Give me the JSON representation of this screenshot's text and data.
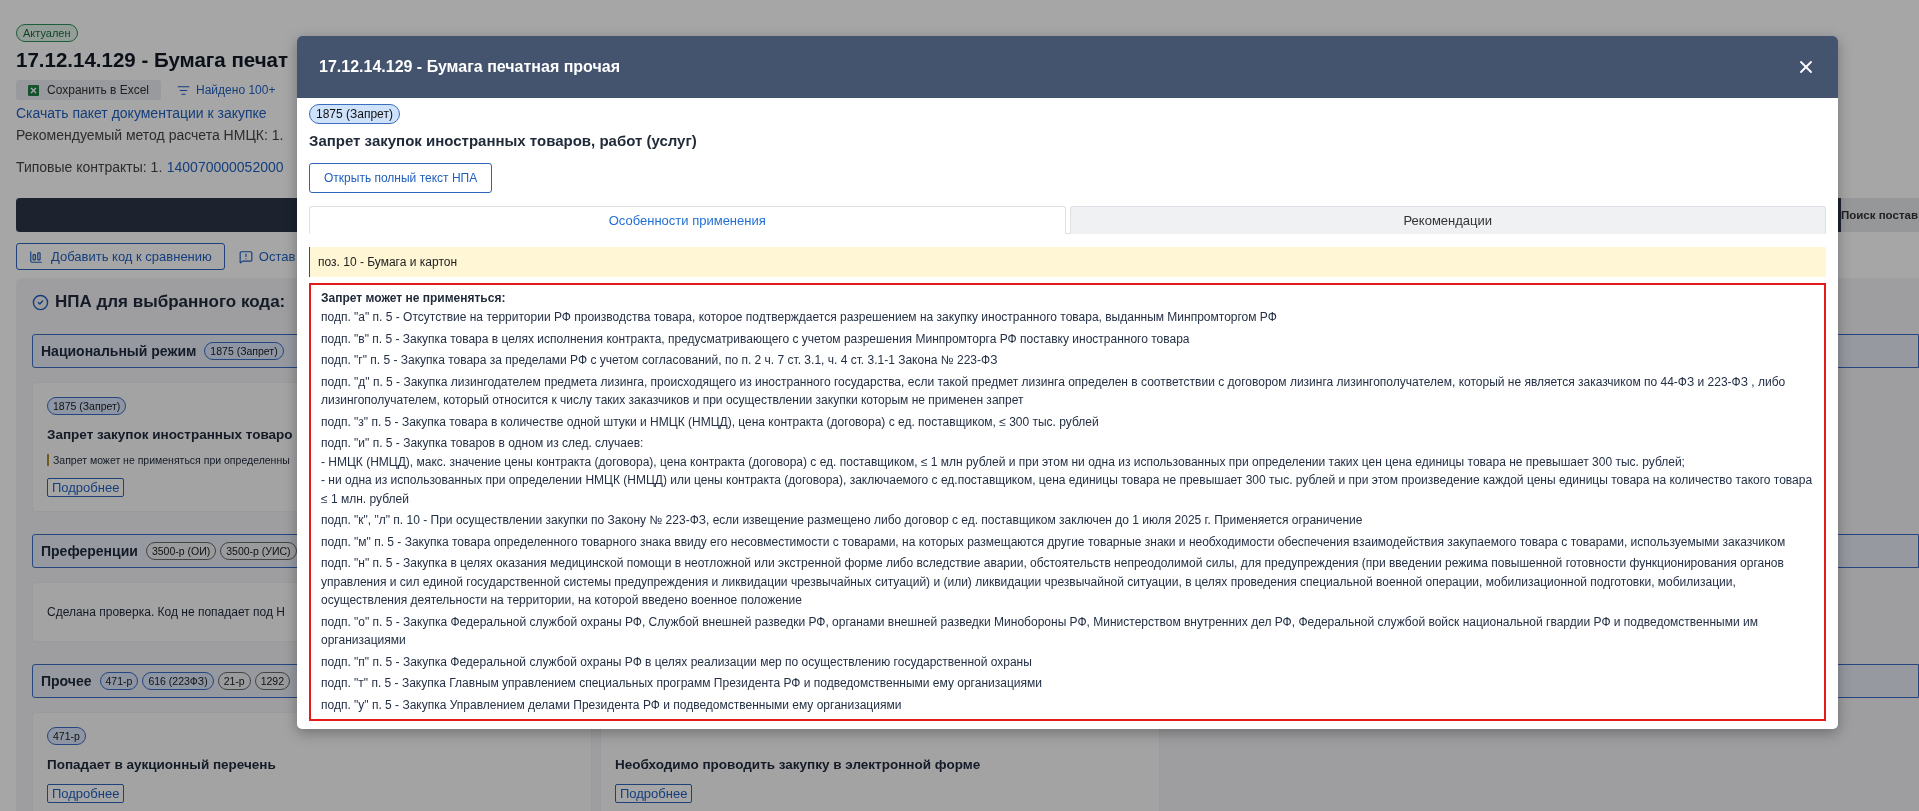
{
  "background": {
    "status_badge": "Актуален",
    "title": "17.12.14.129 - Бумага печат",
    "actions": [
      {
        "kind": "excel",
        "label": "Сохранить в Excel"
      },
      {
        "kind": "found",
        "label": "Найдено 100+"
      }
    ],
    "download_link": "Скачать пакет документации к закупке",
    "method": "Рекомендуемый метод расчета НМЦК: 1.",
    "contracts": {
      "label": "Типовые контракты: 1.",
      "link": "140070000052000"
    },
    "right_tab": "Поиск постав",
    "buttons": [
      {
        "kind": "compare",
        "label": "Добавить код к сравнению"
      },
      {
        "kind": "comment",
        "label": "Остав"
      }
    ],
    "npa_heading": "НПА для выбранного кода:",
    "sections": [
      {
        "title": "Национальный режим",
        "chips": [
          {
            "label": "1875 (Запрет)",
            "color": "#8e96a3"
          }
        ],
        "cards": [
          {
            "chip": "1875 (Запрет)",
            "title": "Запрет закупок иностранных товаро",
            "note": "Запрет может не применяться при определенны",
            "more": "Подробнее"
          }
        ]
      },
      {
        "title": "Преференции",
        "chips": [
          {
            "label": "3500-р (ОИ)",
            "color": "#999b9d"
          },
          {
            "label": "3500-р (УИС)",
            "color": "#999b9d"
          }
        ],
        "cards": [
          {
            "text": "Сделана проверка. Код не попадает под Н"
          }
        ]
      },
      {
        "title": "Прочее",
        "chips": [
          {
            "label": "471-р",
            "color": "#8e96a3"
          },
          {
            "label": "616 (223ФЗ)",
            "color": "#8e96a3"
          },
          {
            "label": "21-р",
            "color": "#999b9d"
          },
          {
            "label": "1292",
            "color": "#999b9d"
          }
        ],
        "cards": [
          {
            "chip": "471-р",
            "title": "Попадает в аукционный перечень",
            "more": "Подробнее"
          },
          {
            "title": "Необходимо проводить закупку в электронной форме",
            "more": "Подробнее"
          }
        ]
      }
    ]
  },
  "modal": {
    "title": "17.12.14.129 - Бумага печатная прочая",
    "chip": "1875 (Запрет)",
    "heading": "Запрет закупок иностранных товаров, работ (услуг)",
    "open_button": "Открыть полный текст НПА",
    "tabs": [
      {
        "label": "Особенности применения",
        "selected": true
      },
      {
        "label": "Рекомендации",
        "selected": false
      }
    ],
    "position_note": "поз. 10 - Бумага и картон",
    "exceptions": {
      "title": "Запрет может не применяться:",
      "items": [
        {
          "lines": [
            "подп. \"а\" п. 5 - Отсутствие на территории РФ производства товара, которое подтверждается разрешением на закупку иностранного товара, выданным Минпромторгом РФ"
          ]
        },
        {
          "lines": [
            "подп. \"в\" п. 5 - Закупка товара в целях исполнения контракта, предусматривающего с учетом разрешения Минпромторга РФ поставку иностранного товара"
          ]
        },
        {
          "lines": [
            "подп. \"г\" п. 5 - Закупка товара за пределами РФ с учетом согласований, по п. 2 ч. 7 ст. 3.1, ч. 4 ст. 3.1-1 Закона № 223-ФЗ"
          ]
        },
        {
          "lines": [
            "подп. \"д\" п. 5 - Закупка лизингодателем предмета лизинга, происходящего из иностранного государства, если такой предмет лизинга определен в соответствии с договором лизинга лизингополучателем, который не является заказчиком по 44-ФЗ и 223-ФЗ , либо лизингополучателем, который относится к числу таких заказчиков и при осуществлении закупки которым не применен запрет"
          ]
        },
        {
          "lines": [
            "подп. \"з\" п. 5 - Закупка товара в количестве одной штуки и НМЦК (НМЦД), цена контракта (договора) с ед. поставщиком, ≤ 300 тыс. рублей"
          ]
        },
        {
          "lines": [
            "подп. \"и\" п. 5 - Закупка товаров в одном из след. случаев:",
            "- НМЦК (НМЦД), макс. значение цены контракта (договора), цена контракта (договора) с ед. поставщиком, ≤ 1 млн рублей и при этом ни одна из использованных при определении таких цен цена единицы товара не превышает 300 тыс. рублей;",
            "- ни одна из использованных при определении НМЦК (НМЦД) или цены контракта (договора), заключаемого с ед.поставщиком, цена единицы товара не превышает 300 тыс. рублей и при этом произведение каждой цены единицы товара на количество такого товара ≤ 1 млн. рублей"
          ]
        },
        {
          "lines": [
            "подп. \"к\", \"л\" п. 10 - При осуществлении закупки по Закону № 223-ФЗ, если извещение размещено либо договор с ед. поставщиком заключен до 1 июля 2025 г. Применяется ограничение"
          ]
        },
        {
          "lines": [
            "подп. \"м\" п. 5 - Закупка товара определенного товарного знака ввиду его несовместимости с товарами, на которых размещаются другие товарные знаки и необходимости обеспечения взаимодействия закупаемого товара с товарами, используемыми заказчиком"
          ]
        },
        {
          "lines": [
            "подп. \"н\" п. 5 - Закупка в целях оказания медицинской помощи в неотложной или экстренной форме либо вследствие аварии, обстоятельств непреодолимой силы, для предупреждения (при введении режима повышенной готовности функционирования органов управления и сил единой государственной системы предупреждения и ликвидации чрезвычайных ситуаций) и (или) ликвидации чрезвычайной ситуации, в целях проведения специальной военной операции, мобилизационной подготовки, мобилизации, осуществления деятельности на территории, на которой введено военное положение"
          ]
        },
        {
          "lines": [
            "подп. \"о\" п. 5 - Закупка Федеральной службой охраны РФ, Службой внешней разведки РФ, органами внешней разведки Минобороны РФ, Министерством внутренних дел РФ, Федеральной службой войск национальной гвардии РФ и подведомственными им организациями"
          ]
        },
        {
          "lines": [
            "подп. \"п\" п. 5 - Закупка Федеральной службой охраны РФ в целях реализации мер по осуществлению государственной охраны"
          ]
        },
        {
          "lines": [
            "подп. \"т\" п. 5 - Закупка Главным управлением специальных программ Президента РФ и подведомственными ему организациями"
          ]
        },
        {
          "lines": [
            "подп. \"у\" п. 5 - Закупка Управлением делами Президента РФ и подведомственными ему организациями"
          ]
        }
      ]
    }
  }
}
